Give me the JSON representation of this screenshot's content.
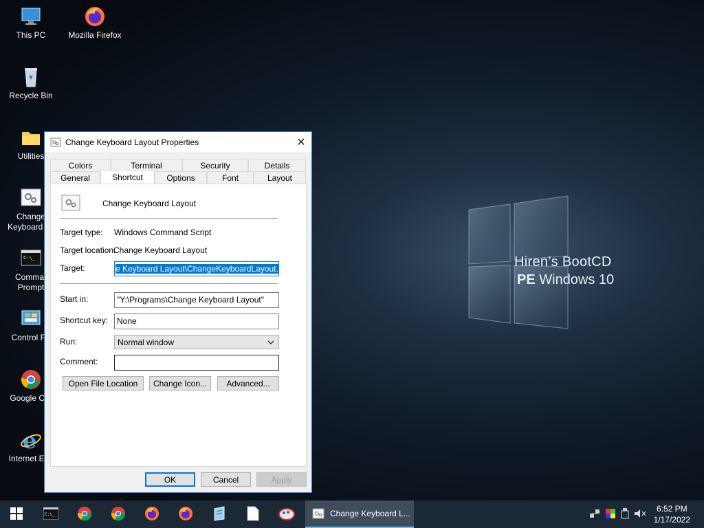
{
  "wallpaper": {
    "line1": "Hiren’s BootCD",
    "line2_bold": "PE",
    "line2_rest": " Windows 10"
  },
  "desktop_icons": [
    {
      "label": "This PC"
    },
    {
      "label": "Mozilla Firefox"
    },
    {
      "label": "Recycle Bin"
    },
    {
      "label": "Utilities"
    },
    {
      "label": "Change Keyboard La",
      "label_line1": "Change",
      "label_line2": "Keyboard La"
    },
    {
      "label_line1": "Commar",
      "label_line2": "Prompt"
    },
    {
      "label": "Control Pa"
    },
    {
      "label": "Google Chr"
    },
    {
      "label": "Internet Exp"
    }
  ],
  "dialog": {
    "title": "Change Keyboard Layout Properties",
    "tabs_row1": [
      "Colors",
      "Terminal",
      "Security",
      "Details"
    ],
    "tabs_row2": [
      "General",
      "Shortcut",
      "Options",
      "Font",
      "Layout"
    ],
    "active_tab": "Shortcut",
    "shortcut_name": "Change Keyboard Layout",
    "target_type_label": "Target type:",
    "target_type_value": "Windows Command Script",
    "target_location_label": "Target location:",
    "target_location_value": "Change Keyboard Layout",
    "target_label": "Target:",
    "target_value": "e Keyboard Layout\\ChangeKeyboardLayout.cmd\"",
    "start_in_label": "Start in:",
    "start_in_value": "\"Y:\\Programs\\Change Keyboard Layout\"",
    "shortcut_key_label": "Shortcut key:",
    "shortcut_key_value": "None",
    "run_label": "Run:",
    "run_value": "Normal window",
    "comment_label": "Comment:",
    "comment_value": "",
    "btn_open_location": "Open File Location",
    "btn_change_icon": "Change Icon...",
    "btn_advanced": "Advanced...",
    "btn_ok": "OK",
    "btn_cancel": "Cancel",
    "btn_apply": "Apply"
  },
  "taskbar": {
    "active_window": "Change Keyboard L...",
    "time": "6:52 PM",
    "date": "1/17/2022"
  }
}
